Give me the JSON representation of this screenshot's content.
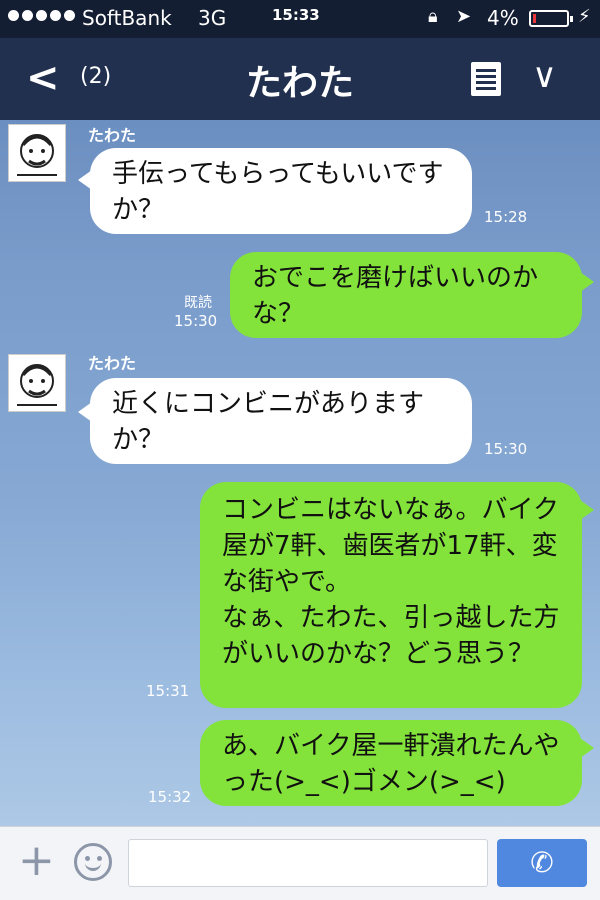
{
  "status_bar": {
    "carrier": "SoftBank",
    "network": "3G",
    "time": "15:33",
    "battery": "4%",
    "battery_level": 0.04,
    "icons": [
      "signal-dots",
      "orientation-lock-icon",
      "location-arrow-icon",
      "battery-icon",
      "charging-bolt-icon"
    ]
  },
  "nav": {
    "back_glyph": "<",
    "unread_count": "(2)",
    "title": "たわた"
  },
  "messages": [
    {
      "from": "other",
      "sender": "たわた",
      "text": "手伝ってもらってもいいですか？",
      "time": "15:28"
    },
    {
      "from": "me",
      "text": "おでこを磨けばいいのかな？",
      "read_label": "既読",
      "time": "15:30"
    },
    {
      "from": "other",
      "sender": "たわた",
      "text": "近くにコンビニがありますか？",
      "time": "15:30"
    },
    {
      "from": "me",
      "text": "コンビニはないなぁ。バイク屋が7軒、歯医者が17軒、変な街やで。\nなぁ、たわた、引っ越した方がいいのかな？どう思う？",
      "time": "15:31"
    },
    {
      "from": "me",
      "text": "あ、バイク屋一軒潰れたんやった(>_<)ゴメン(>_<)",
      "time": "15:32"
    }
  ],
  "colors": {
    "nav_bg": "#20304e",
    "status_bg": "#141e33",
    "bubble_out": "#84e33a",
    "bubble_in": "#ffffff",
    "call_button": "#4f88de"
  }
}
